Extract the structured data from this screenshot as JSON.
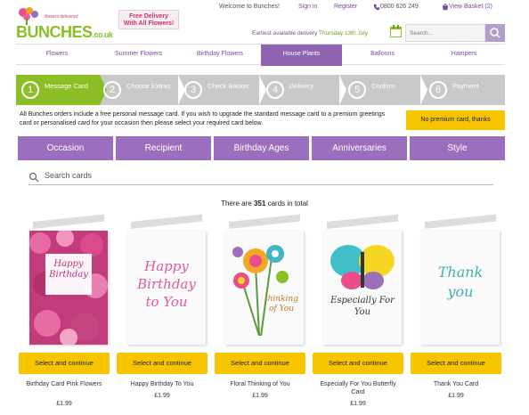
{
  "header": {
    "logo_tagline": "flowers delivered",
    "logo_brand": "BUNCHES",
    "logo_tld": ".co.uk",
    "free_delivery_line1": "Free Delivery",
    "free_delivery_line2": "With All Flowers!",
    "welcome": "Welcome to Bunches!",
    "sign_in": "Sign in",
    "register": "Register",
    "phone": "0800 626 249",
    "basket": "View Basket (2)",
    "earliest_label": "Earliest available delivery",
    "earliest_date": "Thursday 13th July",
    "search_placeholder": "Search..."
  },
  "nav": [
    "Flowers",
    "Summer Flowers",
    "Birthday Flowers",
    "House Plants",
    "Balloons",
    "Hampers"
  ],
  "nav_active": "House Plants",
  "steps": [
    {
      "num": "1",
      "label": "Message Card"
    },
    {
      "num": "2",
      "label": "Choose Extras"
    },
    {
      "num": "3",
      "label": "Check Basket"
    },
    {
      "num": "4",
      "label": "Delivery"
    },
    {
      "num": "5",
      "label": "Confirm"
    },
    {
      "num": "6",
      "label": "Payment"
    }
  ],
  "intro_text": "All Bunches orders include a free personal message card. If you wish to upgrade the standard message card to a premium greetings card or personalised card for your occasion then please select your required card below.",
  "no_premium_button": "No premium card, thanks",
  "categories": [
    "Occasion",
    "Recipient",
    "Birthday Ages",
    "Anniversaries",
    "Style"
  ],
  "search_cards_placeholder": "Search cards",
  "count_prefix": "There are",
  "count_value": "351",
  "count_suffix": "cards in total",
  "cards": [
    {
      "name": "Birthday Card Pink Flowers",
      "price": "£1.99",
      "button": "Select and continue",
      "art_text": "Happy Birthday"
    },
    {
      "name": "Happy Birthday To You",
      "price": "£1.99",
      "button": "Select and continue",
      "art_text": "Happy Birthday to You"
    },
    {
      "name": "Floral Thinking of You",
      "price": "£1.99",
      "button": "Select and continue",
      "art_text": "thinking of You"
    },
    {
      "name": "Especially For You Butterfly Card",
      "price": "£1.99",
      "button": "Select and continue",
      "art_text": "Especially For You"
    },
    {
      "name": "Thank You Card",
      "price": "£1.99",
      "button": "Select and continue",
      "art_text": "Thank you"
    }
  ],
  "colors": {
    "purple": "#8e63b2",
    "category_purple": "#9b6fbd",
    "green": "#8cbf26",
    "yellow": "#f7c500",
    "pink": "#d0306a"
  }
}
